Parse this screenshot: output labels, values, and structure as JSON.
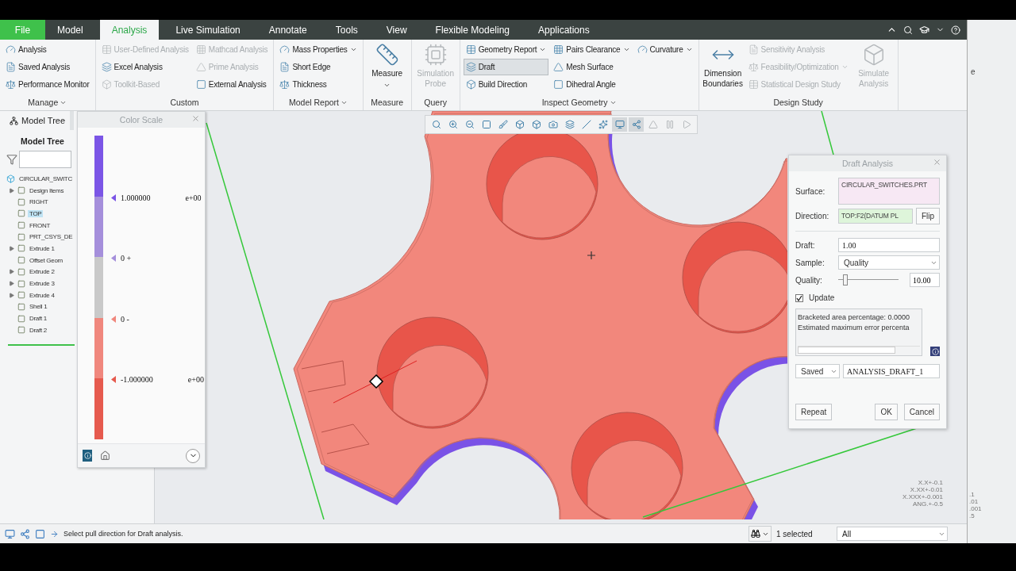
{
  "tabs": [
    {
      "label": "File",
      "kind": "file",
      "selected": false
    },
    {
      "label": "Model",
      "kind": "tab",
      "selected": false
    },
    {
      "label": "Analysis",
      "kind": "tab",
      "selected": true
    },
    {
      "label": "Live Simulation",
      "kind": "tab",
      "selected": false
    },
    {
      "label": "Annotate",
      "kind": "tab",
      "selected": false
    },
    {
      "label": "Tools",
      "kind": "tab",
      "selected": false
    },
    {
      "label": "View",
      "kind": "tab",
      "selected": false
    },
    {
      "label": "Flexible Modeling",
      "kind": "tab",
      "selected": false
    },
    {
      "label": "Applications",
      "kind": "tab",
      "selected": false
    }
  ],
  "ribbon": [
    {
      "title": "Manage",
      "menu": true,
      "columns": [
        [
          {
            "label": "Analysis",
            "kind": "small",
            "disabled": false,
            "selected": false
          },
          {
            "label": "Saved Analysis",
            "kind": "small",
            "disabled": false,
            "selected": false
          },
          {
            "label": "Performance Monitor",
            "kind": "small",
            "disabled": false,
            "selected": false
          }
        ]
      ]
    },
    {
      "title": "Custom",
      "menu": false,
      "columns": [
        [
          {
            "label": "User-Defined Analysis",
            "kind": "small",
            "disabled": true,
            "selected": false
          },
          {
            "label": "Excel Analysis",
            "kind": "small",
            "disabled": false,
            "selected": false
          },
          {
            "label": "Toolkit-Based",
            "kind": "small",
            "disabled": true,
            "selected": false
          }
        ],
        [
          {
            "label": "Mathcad Analysis",
            "kind": "small",
            "disabled": true,
            "selected": false
          },
          {
            "label": "Prime Analysis",
            "kind": "small",
            "disabled": true,
            "selected": false
          },
          {
            "label": "External Analysis",
            "kind": "small",
            "disabled": false,
            "selected": false
          }
        ]
      ]
    },
    {
      "title": "Model Report",
      "menu": true,
      "columns": [
        [
          {
            "label": "Mass Properties",
            "kind": "small",
            "menu": true,
            "disabled": false,
            "selected": false
          },
          {
            "label": "Short Edge",
            "kind": "small",
            "disabled": false,
            "selected": false
          },
          {
            "label": "Thickness",
            "kind": "small",
            "disabled": false,
            "selected": false
          }
        ]
      ]
    },
    {
      "title": "Measure",
      "menu": false,
      "columns": [
        [
          {
            "label": "Measure",
            "kind": "large",
            "menu": true,
            "disabled": false,
            "selected": false
          }
        ]
      ]
    },
    {
      "title": "Query",
      "menu": false,
      "columns": [
        [
          {
            "label": "Simulation Probe",
            "kind": "large",
            "disabled": true,
            "selected": false
          }
        ]
      ]
    },
    {
      "title": "Inspect Geometry",
      "menu": true,
      "columns": [
        [
          {
            "label": "Geometry Report",
            "kind": "small",
            "menu": true,
            "disabled": false,
            "selected": false
          },
          {
            "label": "Draft",
            "kind": "small",
            "disabled": false,
            "selected": true
          },
          {
            "label": "Build Direction",
            "kind": "small",
            "disabled": false,
            "selected": false
          }
        ],
        [
          {
            "label": "Pairs Clearance",
            "kind": "small",
            "menu": true,
            "disabled": false,
            "selected": false
          },
          {
            "label": "Mesh Surface",
            "kind": "small",
            "disabled": false,
            "selected": false
          },
          {
            "label": "Dihedral Angle",
            "kind": "small",
            "disabled": false,
            "selected": false
          }
        ],
        [
          {
            "label": "Curvature",
            "kind": "small",
            "menu": true,
            "disabled": false,
            "selected": false
          }
        ]
      ]
    },
    {
      "title": "Design Study",
      "menu": false,
      "columns": [
        [
          {
            "label": "Dimension Boundaries",
            "kind": "large",
            "disabled": false,
            "selected": false
          }
        ],
        [
          {
            "label": "Sensitivity Analysis",
            "kind": "small",
            "disabled": true,
            "selected": false
          },
          {
            "label": "Feasibility/Optimization",
            "kind": "small",
            "menu": true,
            "disabled": true,
            "selected": false
          },
          {
            "label": "Statistical Design Study",
            "kind": "small",
            "disabled": true,
            "selected": false
          }
        ],
        [
          {
            "label": "Simulate Analysis",
            "kind": "large",
            "disabled": true,
            "selected": false
          }
        ]
      ]
    }
  ],
  "model_tree": {
    "tab": "Model Tree",
    "title": "Model Tree",
    "root": {
      "label": "CIRCULAR_SWITC",
      "selected": false,
      "children": [
        {
          "label": "Design Items",
          "expanded": false,
          "selected": false
        },
        {
          "label": "RIGHT",
          "selected": false
        },
        {
          "label": "TOP",
          "selected": true
        },
        {
          "label": "FRONT",
          "selected": false
        },
        {
          "label": "PRT_CSYS_DE",
          "selected": false
        },
        {
          "label": "Extrude 1",
          "expanded": false,
          "selected": false
        },
        {
          "label": "Offset Geom",
          "selected": false
        },
        {
          "label": "Extrude 2",
          "expanded": false,
          "selected": false
        },
        {
          "label": "Extrude 3",
          "expanded": false,
          "selected": false
        },
        {
          "label": "Extrude 4",
          "expanded": false,
          "selected": false
        },
        {
          "label": "Shell 1",
          "selected": false
        },
        {
          "label": "Draft 1",
          "selected": false
        },
        {
          "label": "Draft 2",
          "selected": false
        }
      ]
    }
  },
  "color_scale": {
    "title": "Color Scale",
    "segments": [
      {
        "color": "#7b55e6"
      },
      {
        "color": "#a58fdb"
      },
      {
        "color": "#c9c9c9"
      },
      {
        "color": "#f0877d"
      },
      {
        "color": "#e65a4e"
      }
    ],
    "labels": [
      {
        "value": "1.000000",
        "exponent": "e+00",
        "color": "#7b55e6"
      },
      {
        "value": "0 +",
        "color": "#a58fdb"
      },
      {
        "value": "0 -",
        "color": "#f0877d"
      },
      {
        "value": "-1.000000",
        "exponent": "e+00",
        "color": "#e65a4e"
      }
    ]
  },
  "view_toolbar": [
    {
      "selected": false,
      "disabled": false
    },
    {
      "selected": false,
      "disabled": false
    },
    {
      "selected": false,
      "disabled": false
    },
    {
      "selected": false,
      "disabled": false
    },
    {
      "selected": false,
      "disabled": false
    },
    {
      "selected": false,
      "disabled": false
    },
    {
      "selected": false,
      "disabled": false
    },
    {
      "selected": false,
      "disabled": false
    },
    {
      "selected": false,
      "disabled": false
    },
    {
      "selected": false,
      "disabled": false
    },
    {
      "selected": false,
      "disabled": false
    },
    {
      "selected": true,
      "disabled": false
    },
    {
      "selected": true,
      "disabled": false
    },
    {
      "selected": false,
      "disabled": true
    },
    {
      "selected": false,
      "disabled": true
    },
    {
      "selected": false,
      "disabled": true
    }
  ],
  "tolerances": [
    "X.X+-0.1",
    "X.XX+-0.01",
    "X.XXX+-0.001",
    "ANG.+-0.5"
  ],
  "draft_dialog": {
    "title": "Draft Analysis",
    "collectors": [
      {
        "label": "Surface:",
        "value": "CIRCULAR_SWITCHES.PRT",
        "color": "#f7e8f4"
      },
      {
        "label": "Direction:",
        "value": "TOP:F2(DATUM PL",
        "color": "#def5da",
        "button": "Flip"
      }
    ],
    "draft": {
      "label": "Draft:",
      "value": "1.00"
    },
    "sample": {
      "label": "Sample:",
      "value": "Quality"
    },
    "quality": {
      "label": "Quality:",
      "level": 0.12,
      "value": "10.00"
    },
    "update": {
      "label": "Update",
      "checked": true
    },
    "results": [
      "Bracketed area percentage: 0.0000",
      "Estimated maximum  error percenta"
    ],
    "saved": {
      "option": "Saved",
      "name": "ANALYSIS_DRAFT_1"
    },
    "buttons": [
      "Repeat",
      "OK",
      "Cancel"
    ]
  },
  "status_bar": {
    "message": "Select pull direction for Draft analysis.",
    "selection": "1 selected",
    "filter": "All"
  },
  "background_window": {
    "text": "e",
    "tolerances": [
      ".1",
      ".01",
      ".001",
      ".5"
    ]
  }
}
